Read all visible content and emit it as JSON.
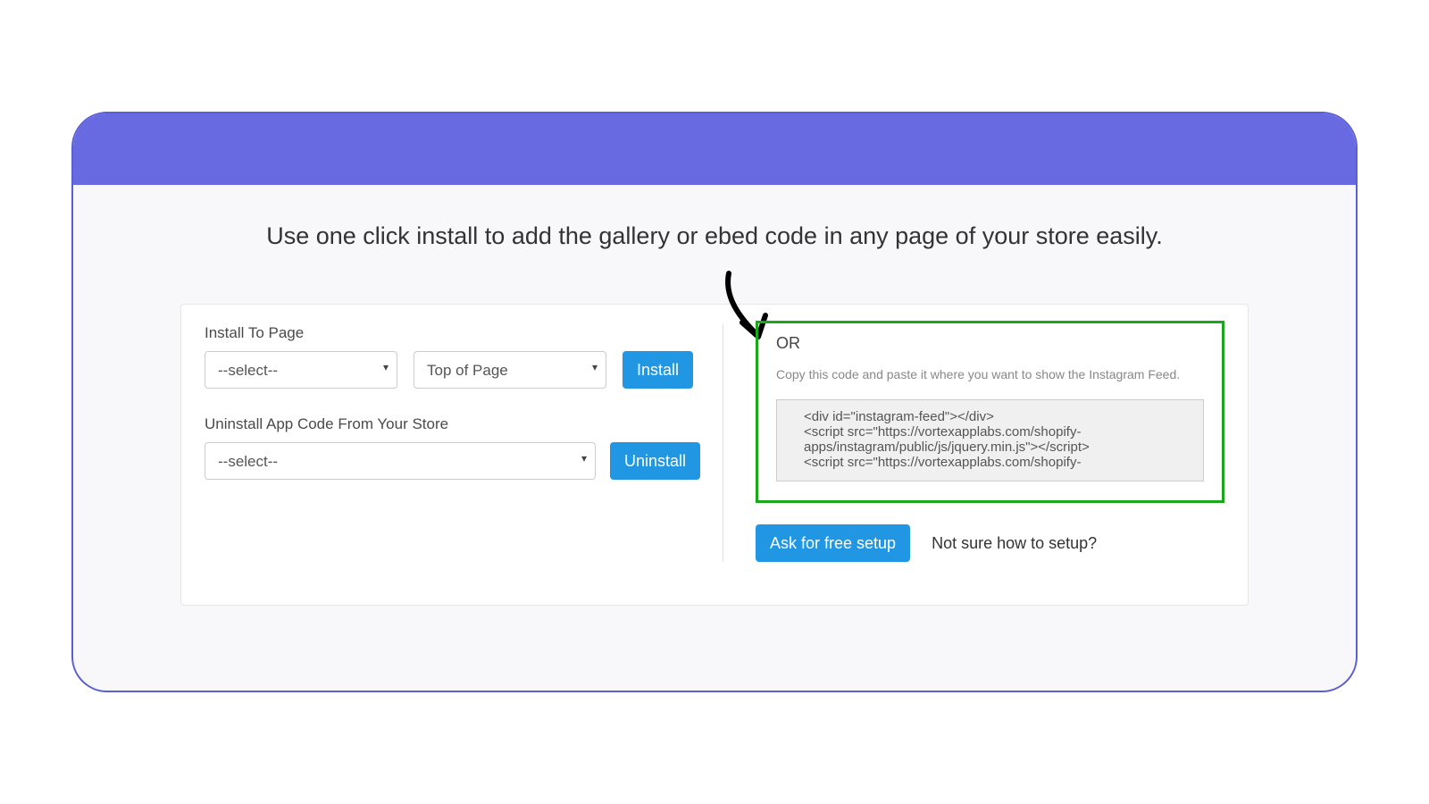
{
  "heading": "Use one click install to add the gallery or ebed code in any page of your store easily.",
  "left": {
    "install_label": "Install To Page",
    "page_select": "--select--",
    "position_select": "Top of Page",
    "install_btn": "Install",
    "uninstall_label": "Uninstall App Code From Your Store",
    "uninstall_select": "--select--",
    "uninstall_btn": "Uninstall"
  },
  "right": {
    "or_label": "OR",
    "copy_instruction": "Copy this code and paste it where you want to show the Instagram Feed.",
    "embed_code": "<div id=\"instagram-feed\"></div>\n<script src=\"https://vortexapplabs.com/shopify-apps/instagram/public/js/jquery.min.js\"></script>\n<script src=\"https://vortexapplabs.com/shopify-",
    "ask_btn": "Ask for free setup",
    "not_sure": "Not sure how to setup?"
  }
}
